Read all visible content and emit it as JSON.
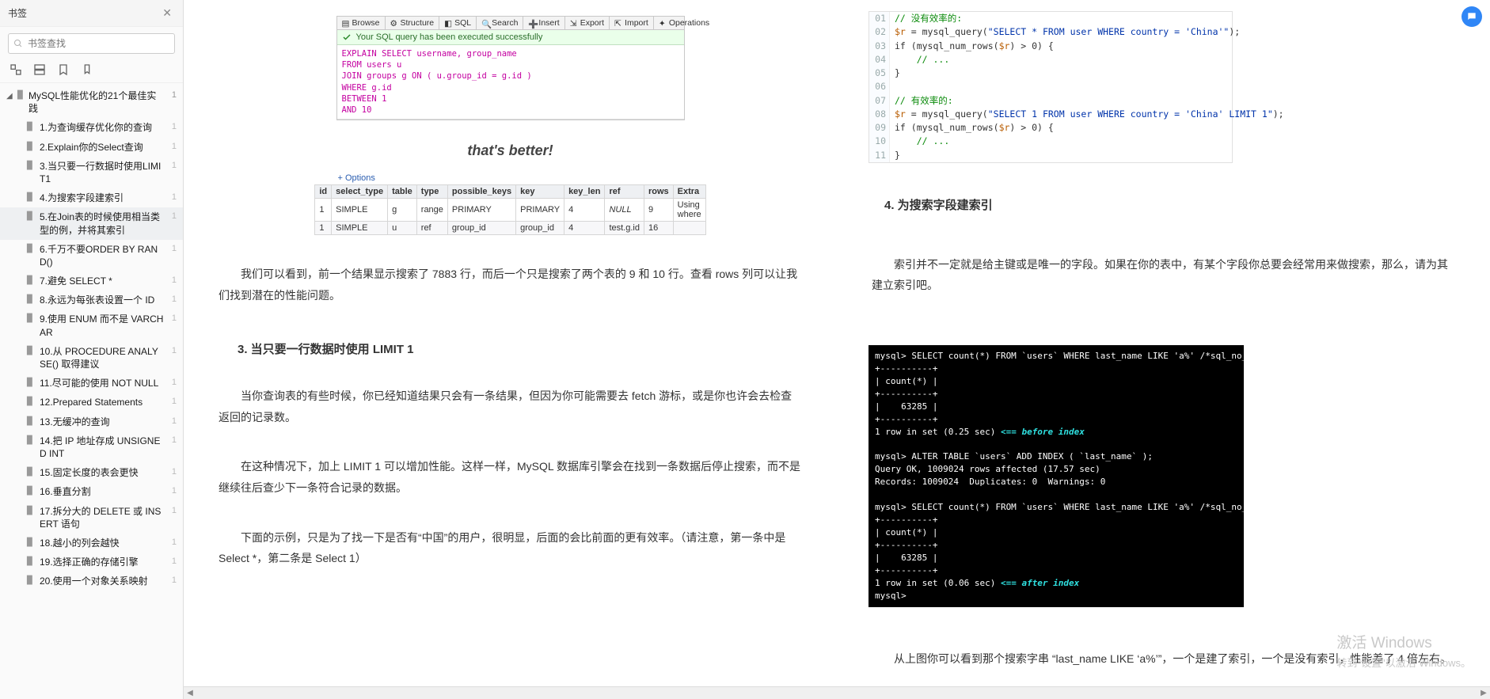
{
  "sidebar": {
    "title": "书签",
    "search_placeholder": "书签查找",
    "root": {
      "label": "MySQL性能优化的21个最佳实践",
      "count": "1"
    },
    "items": [
      {
        "label": "1.为查询缓存优化你的查询",
        "count": "1"
      },
      {
        "label": "2.Explain你的Select查询",
        "count": "1"
      },
      {
        "label": "3.当只要一行数据时使用LIMIT1",
        "count": "1"
      },
      {
        "label": "4.为搜索字段建索引",
        "count": "1"
      },
      {
        "label": "5.在Join表的时候使用相当类型的例，并将其索引",
        "count": "1",
        "active": true
      },
      {
        "label": "6.千万不要ORDER BY RAND()",
        "count": "1"
      },
      {
        "label": "7.避免 SELECT *",
        "count": "1"
      },
      {
        "label": "8.永远为每张表设置一个 ID",
        "count": "1"
      },
      {
        "label": "9.使用 ENUM 而不是 VARCHAR",
        "count": "1"
      },
      {
        "label": "10.从 PROCEDURE ANALYSE() 取得建议",
        "count": "1"
      },
      {
        "label": "11.尽可能的使用 NOT NULL",
        "count": "1"
      },
      {
        "label": "12.Prepared Statements",
        "count": "1"
      },
      {
        "label": "13.无缓冲的查询",
        "count": "1"
      },
      {
        "label": "14.把 IP 地址存成 UNSIGNED INT",
        "count": "1"
      },
      {
        "label": "15.固定长度的表会更快",
        "count": "1"
      },
      {
        "label": "16.垂直分割",
        "count": "1"
      },
      {
        "label": "17.拆分大的 DELETE 或 INSERT 语句",
        "count": "1"
      },
      {
        "label": "18.越小的列会越快",
        "count": "1"
      },
      {
        "label": "19.选择正确的存储引擎",
        "count": "1"
      },
      {
        "label": "20.使用一个对象关系映射",
        "count": "1"
      }
    ]
  },
  "pma": {
    "tabs": [
      "Browse",
      "Structure",
      "SQL",
      "Search",
      "Insert",
      "Export",
      "Import",
      "Operations"
    ],
    "ok": "Your SQL query has been executed successfully",
    "sql_lines": [
      {
        "t": "EXPLAIN SELECT username, group_name",
        "c": "kw"
      },
      {
        "t": "FROM users u",
        "c": "kw"
      },
      {
        "t": "JOIN groups g ON ( u.group_id = g.id )",
        "c": "kw"
      },
      {
        "t": "WHERE g.id",
        "c": "kw"
      },
      {
        "t": "BETWEEN 1",
        "c": "kw"
      },
      {
        "t": "AND 10",
        "c": "kw"
      }
    ],
    "better": "that's better!",
    "options": "+ Options",
    "headers": [
      "id",
      "select_type",
      "table",
      "type",
      "possible_keys",
      "key",
      "key_len",
      "ref",
      "rows",
      "Extra"
    ],
    "rows": [
      [
        "1",
        "SIMPLE",
        "g",
        "range",
        "PRIMARY",
        "PRIMARY",
        "4",
        "NULL",
        "9",
        "Using where"
      ],
      [
        "1",
        "SIMPLE",
        "u",
        "ref",
        "group_id",
        "group_id",
        "4",
        "test.g.id",
        "16",
        ""
      ]
    ]
  },
  "left": {
    "p1": "我们可以看到，前一个结果显示搜索了 7883 行，而后一个只是搜索了两个表的 9 和 10 行。查看 rows 列可以让我们找到潜在的性能问题。",
    "h3": "3. 当只要一行数据时使用 LIMIT 1",
    "p2": "当你查询表的有些时候，你已经知道结果只会有一条结果，但因为你可能需要去 fetch 游标，或是你也许会去检查返回的记录数。",
    "p3": "在这种情况下，加上 LIMIT 1 可以增加性能。这样一样，MySQL 数据库引擎会在找到一条数据后停止搜索，而不是继续往后查少下一条符合记录的数据。",
    "p4": "下面的示例，只是为了找一下是否有“中国”的用户，很明显，后面的会比前面的更有效率。（请注意，第一条中是 Select *，第二条是 Select 1）"
  },
  "code": {
    "lines": [
      {
        "n": "01",
        "h": "<span class='cmt'>// 没有效率的:</span>"
      },
      {
        "n": "02",
        "h": "<span class='var'>$r</span> = mysql_query(<span class='str'>\"SELECT * FROM user WHERE country = 'China'\"</span>);"
      },
      {
        "n": "03",
        "h": "if (mysql_num_rows(<span class='var'>$r</span>) &gt; 0) {"
      },
      {
        "n": "04",
        "h": "    <span class='cmt'>// ...</span>"
      },
      {
        "n": "05",
        "h": "}"
      },
      {
        "n": "06",
        "h": ""
      },
      {
        "n": "07",
        "h": "<span class='cmt'>// 有效率的:</span>"
      },
      {
        "n": "08",
        "h": "<span class='var'>$r</span> = mysql_query(<span class='str'>\"SELECT 1 FROM user WHERE country = 'China' LIMIT 1\"</span>);"
      },
      {
        "n": "09",
        "h": "if (mysql_num_rows(<span class='var'>$r</span>) &gt; 0) {"
      },
      {
        "n": "10",
        "h": "    <span class='cmt'>// ...</span>"
      },
      {
        "n": "11",
        "h": "}"
      }
    ]
  },
  "right": {
    "h4": "4. 为搜索字段建索引",
    "p1": "索引并不一定就是给主键或是唯一的字段。如果在你的表中，有某个字段你总要会经常用来做搜索，那么，请为其建立索引吧。",
    "p2": "从上图你可以看到那个搜索字串 “last_name LIKE ‘a%’”，一个是建了索引，一个是没有索引，性能差了 4 倍左右。"
  },
  "term": {
    "l1": "mysql> SELECT count(*) FROM `users` WHERE last_name LIKE 'a%' /*sql_no_cache*/;",
    "l2": "+----------+",
    "l3": "| count(*) |",
    "l4": "+----------+",
    "l5": "|    63285 |",
    "l6": "+----------+",
    "l7a": "1 row in set (0.25 sec) ",
    "l7b": "<== before index",
    "l8": "",
    "l9": "mysql> ALTER TABLE `users` ADD INDEX ( `last_name` );",
    "l10": "Query OK, 1009024 rows affected (17.57 sec)",
    "l11": "Records: 1009024  Duplicates: 0  Warnings: 0",
    "l12": "",
    "l13": "mysql> SELECT count(*) FROM `users` WHERE last_name LIKE 'a%' /*sql_no_cache*/;",
    "l14": "+----------+",
    "l15": "| count(*) |",
    "l16": "+----------+",
    "l17": "|    63285 |",
    "l18": "+----------+",
    "l19a": "1 row in set (0.06 sec) ",
    "l19b": "<== after index",
    "l20": "mysql>"
  },
  "wm": {
    "l1": "激活 Windows",
    "l2": "转到\"设置\"以激活 Windows。"
  }
}
